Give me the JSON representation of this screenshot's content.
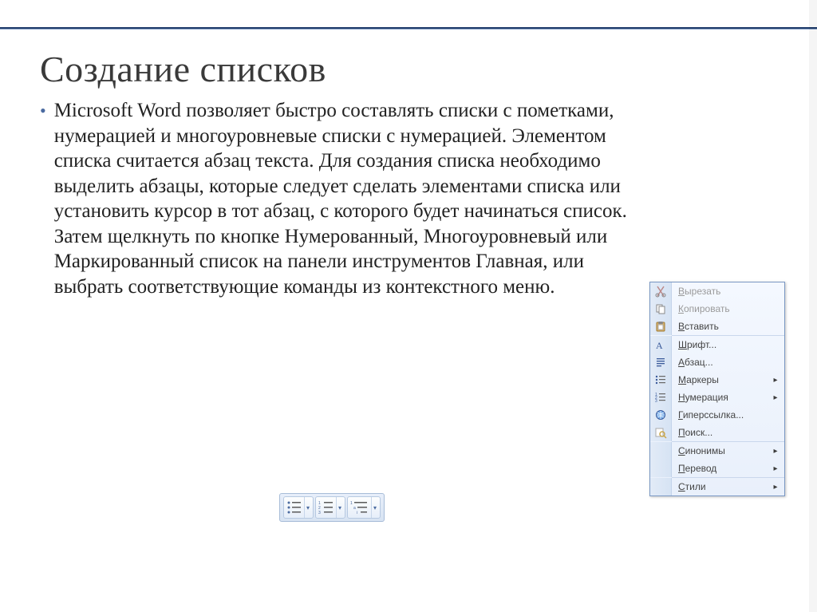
{
  "slide": {
    "title": "Создание списков",
    "bullet_text": "Microsoft Word позволяет быстро составлять списки с пометками, нумерацией и многоуровневые списки с нумерацией. Элементом списка считается абзац текста. Для создания списка необходимо выделить абзацы, которые следует сделать элементами списка или установить курсор в тот абзац, с которого будет начинаться список. Затем щелкнуть по кнопке Нумерованный, Многоуровневый или Маркированный список на панели инструментов Главная, или выбрать соответствующие команды из контекстного меню."
  },
  "context_menu": {
    "items": [
      {
        "icon": "cut",
        "label": "Вырезать",
        "hot": "В",
        "dim": true
      },
      {
        "icon": "copy",
        "label": "Копировать",
        "hot": "К",
        "dim": true
      },
      {
        "icon": "paste",
        "label": "Вставить",
        "hot": "В",
        "dim": false
      },
      {
        "sep": true
      },
      {
        "icon": "font",
        "label": "Шрифт...",
        "hot": "Ш",
        "dim": false
      },
      {
        "icon": "para",
        "label": "Абзац...",
        "hot": "А",
        "dim": false
      },
      {
        "icon": "bullets",
        "label": "Маркеры",
        "hot": "М",
        "dim": false,
        "submenu": true
      },
      {
        "icon": "numbers",
        "label": "Нумерация",
        "hot": "Н",
        "dim": false,
        "submenu": true
      },
      {
        "icon": "hyperlink",
        "label": "Гиперссылка...",
        "hot": "Г",
        "dim": false
      },
      {
        "icon": "search",
        "label": "Поиск...",
        "hot": "П",
        "dim": false
      },
      {
        "sep": true
      },
      {
        "icon": "blank",
        "label": "Синонимы",
        "hot": "С",
        "dim": false,
        "submenu": true
      },
      {
        "icon": "blank",
        "label": "Перевод",
        "hot": "П",
        "dim": false,
        "submenu": true
      },
      {
        "sep": true
      },
      {
        "icon": "blank",
        "label": "Стили",
        "hot": "С",
        "dim": false,
        "submenu": true
      }
    ]
  },
  "ribbon_buttons": {
    "bulleted": "bulleted-list-button",
    "numbered": "numbered-list-button",
    "multilevel": "multilevel-list-button"
  }
}
